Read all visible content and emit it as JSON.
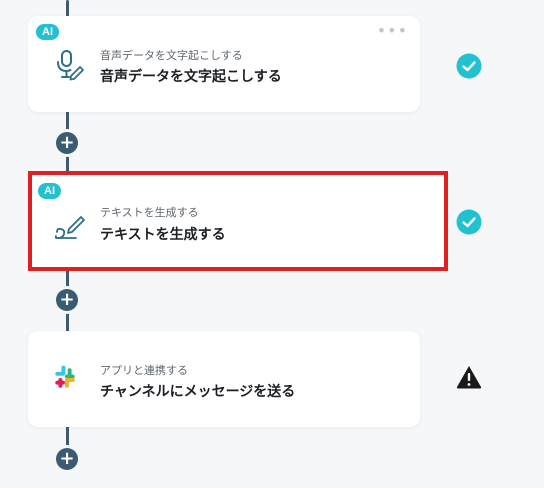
{
  "flow": {
    "steps": [
      {
        "badge": "AI",
        "subtitle": "音声データを文字起こしする",
        "title": "音声データを文字起こしする",
        "icon": "microphone-pen-icon",
        "status": "completed",
        "status_icon": "check-circle-icon",
        "has_more_menu": true,
        "more_icon": "ellipsis-icon"
      },
      {
        "badge": "AI",
        "subtitle": "テキストを生成する",
        "title": "テキストを生成する",
        "icon": "pen-line-icon",
        "status": "completed",
        "status_icon": "check-circle-icon",
        "selected": true
      },
      {
        "badge": "",
        "subtitle": "アプリと連携する",
        "title": "チャンネルにメッセージを送る",
        "icon": "slack-icon",
        "status": "warning",
        "status_icon": "warning-triangle-icon"
      }
    ],
    "add_button_label": "+",
    "add_icon": "plus-icon"
  },
  "colors": {
    "background": "#f6f7f9",
    "connector": "#3f5a6e",
    "add_button": "#3a5b72",
    "ai_badge": "#21c1cf",
    "check": "#21c1cf",
    "warning": "#1a1a1a",
    "selected_border": "#e02020",
    "icon_stroke": "#2f6f88"
  }
}
